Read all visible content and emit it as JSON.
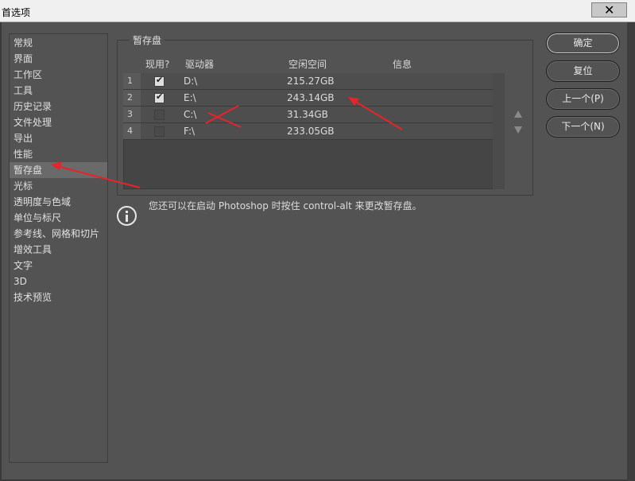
{
  "window": {
    "title": "首选项",
    "close_glyph": "✕"
  },
  "sidebar": {
    "items": [
      {
        "label": "常规"
      },
      {
        "label": "界面"
      },
      {
        "label": "工作区"
      },
      {
        "label": "工具"
      },
      {
        "label": "历史记录"
      },
      {
        "label": "文件处理"
      },
      {
        "label": "导出"
      },
      {
        "label": "性能"
      },
      {
        "label": "暂存盘",
        "active": true
      },
      {
        "label": "光标"
      },
      {
        "label": "透明度与色域"
      },
      {
        "label": "单位与标尺"
      },
      {
        "label": "参考线、网格和切片"
      },
      {
        "label": "增效工具"
      },
      {
        "label": "文字"
      },
      {
        "label": "3D"
      },
      {
        "label": "技术预览"
      }
    ]
  },
  "scratch": {
    "group_label": "暂存盘",
    "columns": {
      "active": "现用?",
      "drive": "驱动器",
      "free": "空闲空间",
      "info": "信息"
    },
    "rows": [
      {
        "num": "1",
        "checked": true,
        "drive": "D:\\",
        "free": "215.27GB",
        "info": ""
      },
      {
        "num": "2",
        "checked": true,
        "drive": "E:\\",
        "free": "243.14GB",
        "info": ""
      },
      {
        "num": "3",
        "checked": false,
        "drive": "C:\\",
        "free": "31.34GB",
        "info": ""
      },
      {
        "num": "4",
        "checked": false,
        "drive": "F:\\",
        "free": "233.05GB",
        "info": ""
      }
    ],
    "move_up_icon": "triangle-up",
    "move_down_icon": "triangle-down"
  },
  "info": {
    "text": "您还可以在启动 Photoshop 时按住 control-alt 来更改暂存盘。"
  },
  "buttons": {
    "ok": "确定",
    "reset": "复位",
    "prev": "上一个(P)",
    "next": "下一个(N)"
  },
  "annotations": {
    "color": "#e8232a"
  }
}
